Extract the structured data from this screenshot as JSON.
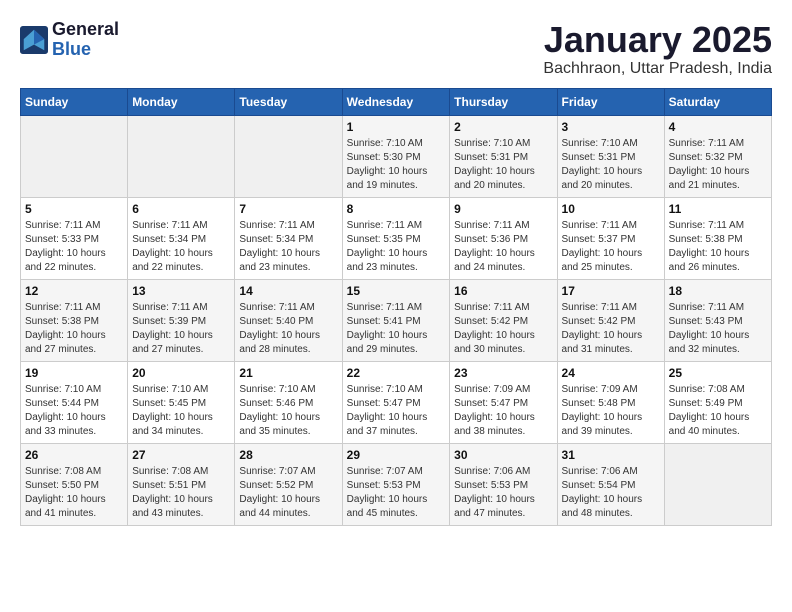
{
  "logo": {
    "text_general": "General",
    "text_blue": "Blue"
  },
  "header": {
    "title": "January 2025",
    "subtitle": "Bachhraon, Uttar Pradesh, India"
  },
  "weekdays": [
    "Sunday",
    "Monday",
    "Tuesday",
    "Wednesday",
    "Thursday",
    "Friday",
    "Saturday"
  ],
  "weeks": [
    [
      {
        "date": "",
        "info": ""
      },
      {
        "date": "",
        "info": ""
      },
      {
        "date": "",
        "info": ""
      },
      {
        "date": "1",
        "info": "Sunrise: 7:10 AM\nSunset: 5:30 PM\nDaylight: 10 hours\nand 19 minutes."
      },
      {
        "date": "2",
        "info": "Sunrise: 7:10 AM\nSunset: 5:31 PM\nDaylight: 10 hours\nand 20 minutes."
      },
      {
        "date": "3",
        "info": "Sunrise: 7:10 AM\nSunset: 5:31 PM\nDaylight: 10 hours\nand 20 minutes."
      },
      {
        "date": "4",
        "info": "Sunrise: 7:11 AM\nSunset: 5:32 PM\nDaylight: 10 hours\nand 21 minutes."
      }
    ],
    [
      {
        "date": "5",
        "info": "Sunrise: 7:11 AM\nSunset: 5:33 PM\nDaylight: 10 hours\nand 22 minutes."
      },
      {
        "date": "6",
        "info": "Sunrise: 7:11 AM\nSunset: 5:34 PM\nDaylight: 10 hours\nand 22 minutes."
      },
      {
        "date": "7",
        "info": "Sunrise: 7:11 AM\nSunset: 5:34 PM\nDaylight: 10 hours\nand 23 minutes."
      },
      {
        "date": "8",
        "info": "Sunrise: 7:11 AM\nSunset: 5:35 PM\nDaylight: 10 hours\nand 23 minutes."
      },
      {
        "date": "9",
        "info": "Sunrise: 7:11 AM\nSunset: 5:36 PM\nDaylight: 10 hours\nand 24 minutes."
      },
      {
        "date": "10",
        "info": "Sunrise: 7:11 AM\nSunset: 5:37 PM\nDaylight: 10 hours\nand 25 minutes."
      },
      {
        "date": "11",
        "info": "Sunrise: 7:11 AM\nSunset: 5:38 PM\nDaylight: 10 hours\nand 26 minutes."
      }
    ],
    [
      {
        "date": "12",
        "info": "Sunrise: 7:11 AM\nSunset: 5:38 PM\nDaylight: 10 hours\nand 27 minutes."
      },
      {
        "date": "13",
        "info": "Sunrise: 7:11 AM\nSunset: 5:39 PM\nDaylight: 10 hours\nand 27 minutes."
      },
      {
        "date": "14",
        "info": "Sunrise: 7:11 AM\nSunset: 5:40 PM\nDaylight: 10 hours\nand 28 minutes."
      },
      {
        "date": "15",
        "info": "Sunrise: 7:11 AM\nSunset: 5:41 PM\nDaylight: 10 hours\nand 29 minutes."
      },
      {
        "date": "16",
        "info": "Sunrise: 7:11 AM\nSunset: 5:42 PM\nDaylight: 10 hours\nand 30 minutes."
      },
      {
        "date": "17",
        "info": "Sunrise: 7:11 AM\nSunset: 5:42 PM\nDaylight: 10 hours\nand 31 minutes."
      },
      {
        "date": "18",
        "info": "Sunrise: 7:11 AM\nSunset: 5:43 PM\nDaylight: 10 hours\nand 32 minutes."
      }
    ],
    [
      {
        "date": "19",
        "info": "Sunrise: 7:10 AM\nSunset: 5:44 PM\nDaylight: 10 hours\nand 33 minutes."
      },
      {
        "date": "20",
        "info": "Sunrise: 7:10 AM\nSunset: 5:45 PM\nDaylight: 10 hours\nand 34 minutes."
      },
      {
        "date": "21",
        "info": "Sunrise: 7:10 AM\nSunset: 5:46 PM\nDaylight: 10 hours\nand 35 minutes."
      },
      {
        "date": "22",
        "info": "Sunrise: 7:10 AM\nSunset: 5:47 PM\nDaylight: 10 hours\nand 37 minutes."
      },
      {
        "date": "23",
        "info": "Sunrise: 7:09 AM\nSunset: 5:47 PM\nDaylight: 10 hours\nand 38 minutes."
      },
      {
        "date": "24",
        "info": "Sunrise: 7:09 AM\nSunset: 5:48 PM\nDaylight: 10 hours\nand 39 minutes."
      },
      {
        "date": "25",
        "info": "Sunrise: 7:08 AM\nSunset: 5:49 PM\nDaylight: 10 hours\nand 40 minutes."
      }
    ],
    [
      {
        "date": "26",
        "info": "Sunrise: 7:08 AM\nSunset: 5:50 PM\nDaylight: 10 hours\nand 41 minutes."
      },
      {
        "date": "27",
        "info": "Sunrise: 7:08 AM\nSunset: 5:51 PM\nDaylight: 10 hours\nand 43 minutes."
      },
      {
        "date": "28",
        "info": "Sunrise: 7:07 AM\nSunset: 5:52 PM\nDaylight: 10 hours\nand 44 minutes."
      },
      {
        "date": "29",
        "info": "Sunrise: 7:07 AM\nSunset: 5:53 PM\nDaylight: 10 hours\nand 45 minutes."
      },
      {
        "date": "30",
        "info": "Sunrise: 7:06 AM\nSunset: 5:53 PM\nDaylight: 10 hours\nand 47 minutes."
      },
      {
        "date": "31",
        "info": "Sunrise: 7:06 AM\nSunset: 5:54 PM\nDaylight: 10 hours\nand 48 minutes."
      },
      {
        "date": "",
        "info": ""
      }
    ]
  ]
}
